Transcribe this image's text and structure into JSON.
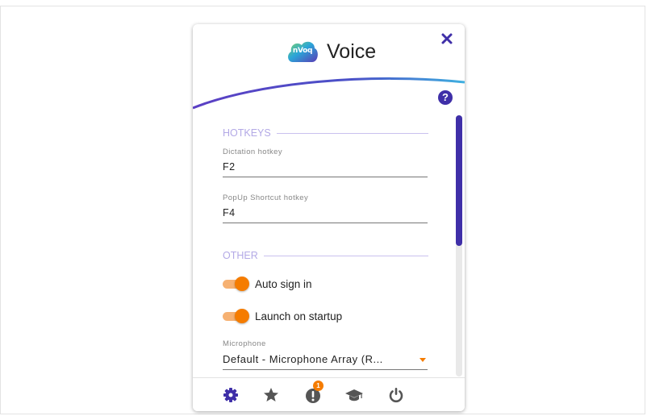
{
  "app": {
    "title": "Voice",
    "logo_text": "nVoq",
    "help_symbol": "?",
    "brand_color": "#3f2fa8",
    "accent_color": "#f57c00"
  },
  "hotkeys": {
    "section_title": "HOTKEYS",
    "dictation": {
      "label": "Dictation hotkey",
      "value": "F2"
    },
    "popup": {
      "label": "PopUp Shortcut hotkey",
      "value": "F4"
    }
  },
  "other": {
    "section_title": "OTHER",
    "auto_sign_in": {
      "label": "Auto sign in",
      "enabled": true
    },
    "launch_on_startup": {
      "label": "Launch on startup",
      "enabled": true
    },
    "microphone": {
      "label": "Microphone",
      "selected": "Default - Microphone Array (R..."
    }
  },
  "footer": {
    "items": [
      {
        "icon": "gear-icon",
        "active": true
      },
      {
        "icon": "star-icon"
      },
      {
        "icon": "alert-icon",
        "badge": "1"
      },
      {
        "icon": "graduation-cap-icon"
      },
      {
        "icon": "power-icon"
      }
    ]
  }
}
